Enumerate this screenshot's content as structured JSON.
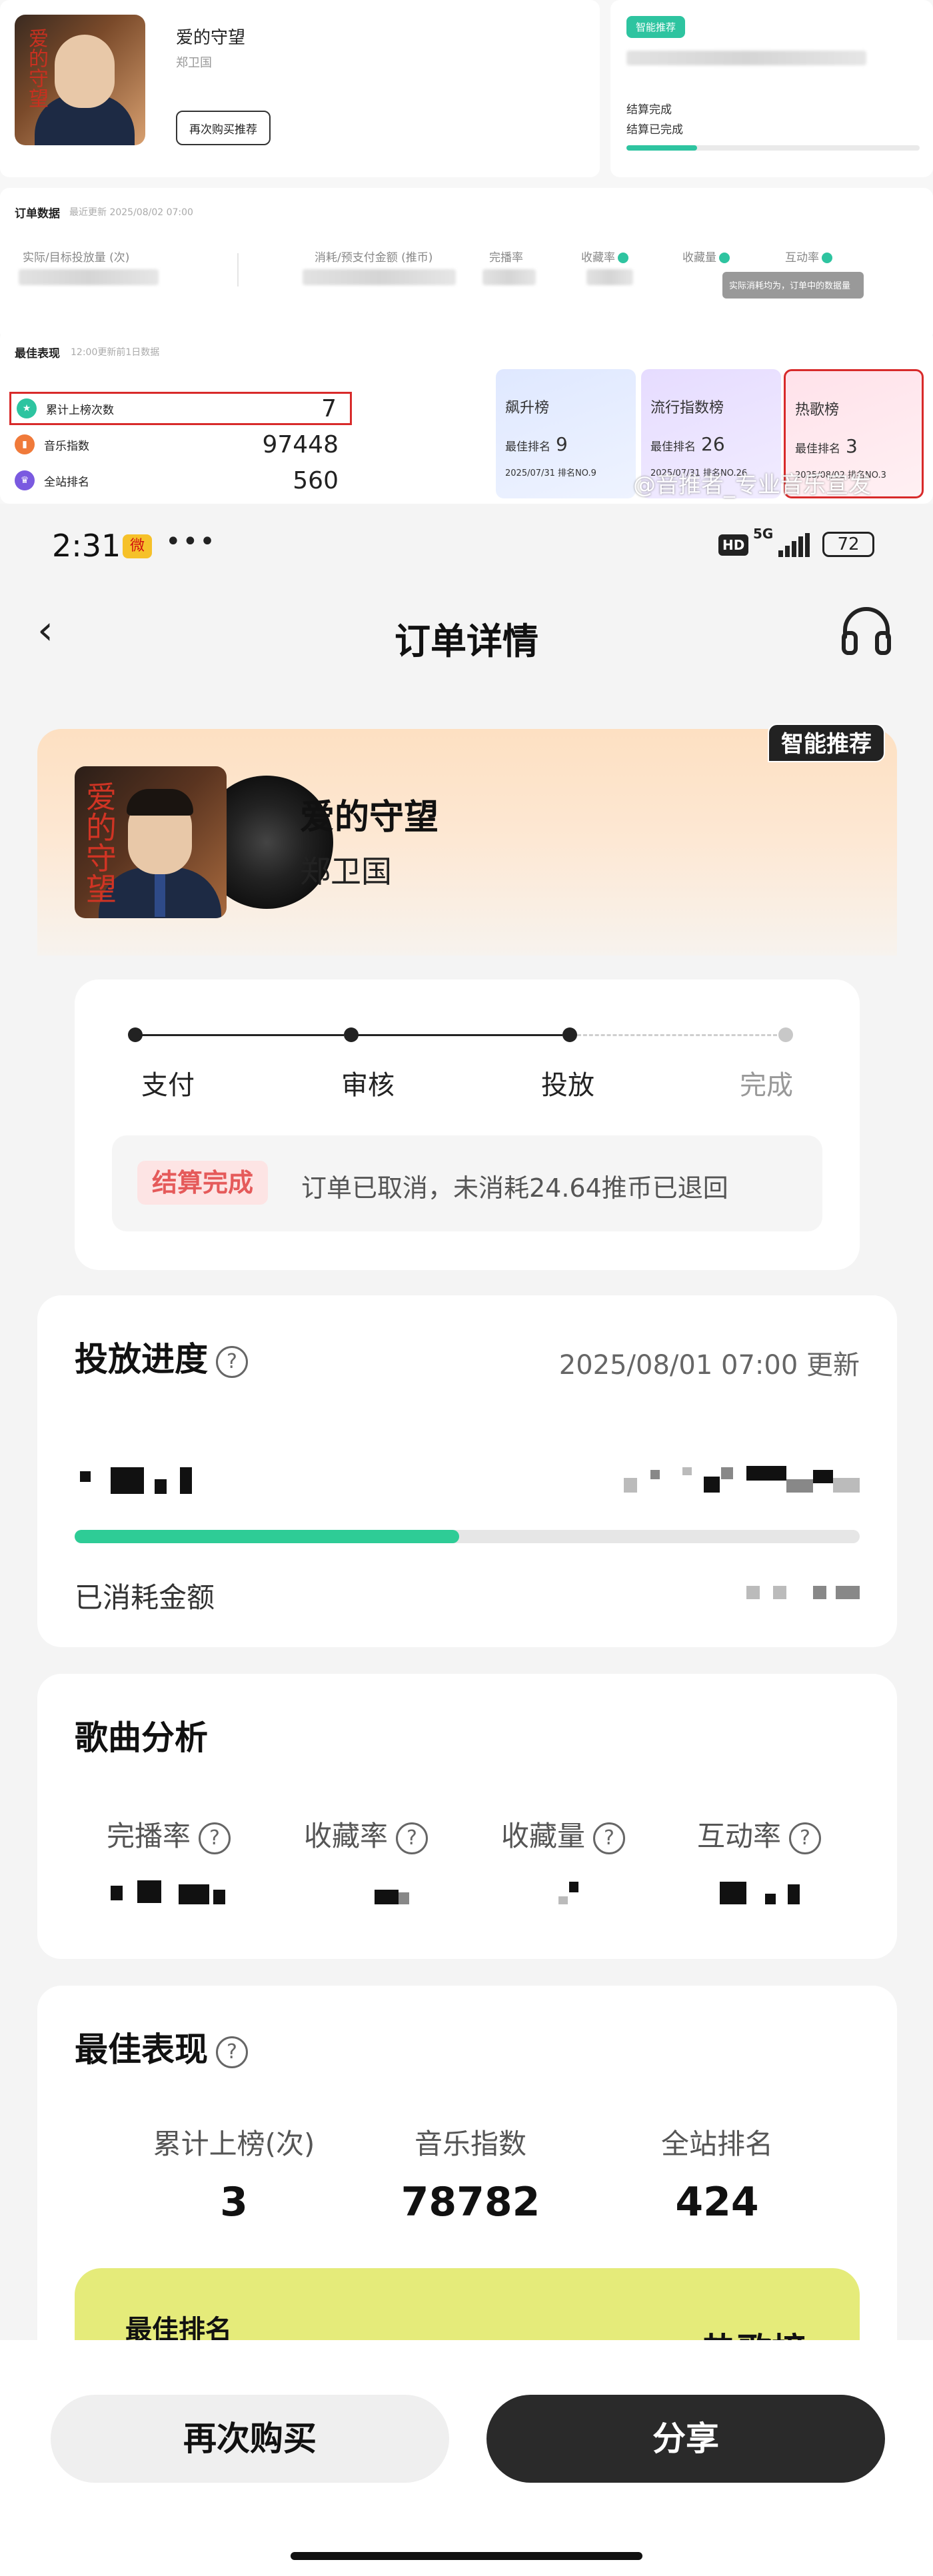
{
  "desktop": {
    "song_title": "爱的守望",
    "artist": "郑卫国",
    "rebuy_button": "再次购买推荐",
    "smart_tag": "智能推荐",
    "status_line1": "结算完成",
    "status_line2": "结算已完成",
    "progress_fraction": 0.24,
    "order_data_label": "订单数据",
    "order_data_sub": "最近更新 2025/08/02 07:00",
    "col_actual": "实际/目标投放量 (次)",
    "col_cost": "消耗/预支付金额 (推币)",
    "col_completion": "完播率",
    "col_favrate": "收藏率",
    "col_favcount": "收藏量",
    "col_interact": "互动率",
    "tooltip": "实际消耗均为，订单中的数据量",
    "best_label": "最佳表现",
    "best_sub": "12:00更新前1日数据",
    "stats": [
      {
        "label": "累计上榜次数",
        "value": "7",
        "icon": "star-icon",
        "color": "#2ec4a0"
      },
      {
        "label": "音乐指数",
        "value": "97448",
        "icon": "chart-icon",
        "color": "#f07a3a"
      },
      {
        "label": "全站排名",
        "value": "560",
        "icon": "trophy-icon",
        "color": "#7a5ae0"
      }
    ],
    "rank_cards": [
      {
        "name": "飙升榜",
        "best_label": "最佳排名",
        "best_value": "9",
        "date": "2025/07/31 排名NO.9"
      },
      {
        "name": "流行指数榜",
        "best_label": "最佳排名",
        "best_value": "26",
        "date": "2025/07/31 排名NO.26"
      },
      {
        "name": "热歌榜",
        "best_label": "最佳排名",
        "best_value": "3",
        "date": "2025/08/02 排名NO.3"
      }
    ],
    "watermark": "@音推者_专业音乐宣发"
  },
  "status_bar": {
    "time": "2:31",
    "app_badge": "微",
    "dots": "•••",
    "hd": "HD",
    "network": "5G",
    "battery": "72"
  },
  "nav": {
    "back_icon": "‹",
    "title": "订单详情",
    "headphones_icon": "headphones-icon"
  },
  "hero": {
    "cover_text": "爱的守望",
    "song_title": "爱的守望",
    "artist": "郑卫国",
    "smart_tag": "智能推荐"
  },
  "steps": {
    "items": [
      "支付",
      "审核",
      "投放",
      "完成"
    ],
    "notice_tag": "结算完成",
    "notice_text": "订单已取消，未消耗24.64推币已退回"
  },
  "delivery": {
    "title": "投放进度",
    "help": "?",
    "updated": "2025/08/01 07:00 更新",
    "progress_fraction": 0.49,
    "spent_label": "已消耗金额"
  },
  "analysis": {
    "title": "歌曲分析",
    "metrics": [
      "完播率",
      "收藏率",
      "收藏量",
      "互动率"
    ],
    "help": "?"
  },
  "best": {
    "title": "最佳表现",
    "help": "?",
    "items": [
      {
        "label": "累计上榜(次)",
        "value": "3"
      },
      {
        "label": "音乐指数",
        "value": "78782"
      },
      {
        "label": "全站排名",
        "value": "424"
      }
    ],
    "banner_title": "最佳排名",
    "banner_right": "热歌榜"
  },
  "bottom": {
    "rebuy": "再次购买",
    "share": "分享"
  }
}
